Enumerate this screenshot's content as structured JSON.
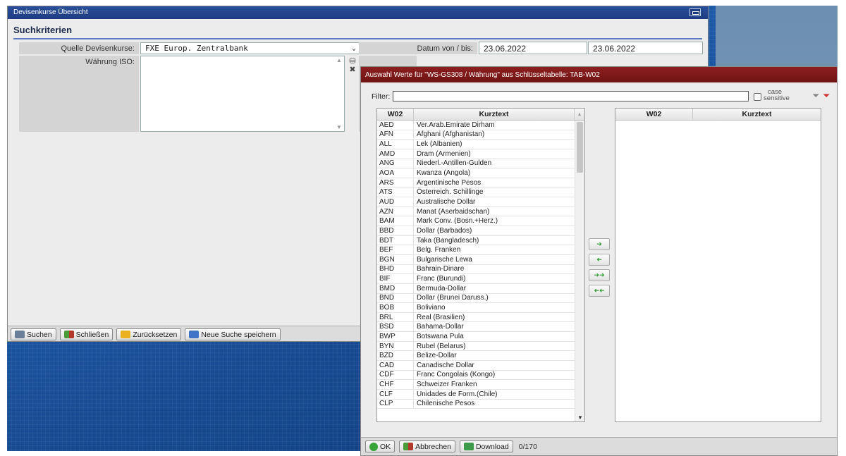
{
  "main": {
    "title": "Devisenkurse Übersicht",
    "section_title": "Suchkriterien",
    "quelle_label": "Quelle Devisenkurse:",
    "quelle_value": "FXE Europ. Zentralbank",
    "datum_label": "Datum von / bis:",
    "datum_from": "23.06.2022",
    "datum_to": "23.06.2022",
    "waehrung_label": "Währung ISO:",
    "buttons": {
      "suchen": "Suchen",
      "schliessen": "Schließen",
      "zuruecksetzen": "Zurücksetzen",
      "neue_suche": "Neue Suche speichern"
    }
  },
  "dialog": {
    "title": "Auswahl Werte für \"WS-GS308 / Währung\" aus Schlüsseltabelle: TAB-W02",
    "filter_label": "Filter:",
    "filter_value": "",
    "case_sensitive_label_1": "case",
    "case_sensitive_label_2": "sensitive",
    "left_headers": [
      "W02",
      "Kurztext"
    ],
    "right_headers": [
      "W02",
      "Kurztext"
    ],
    "rows": [
      [
        "AED",
        "Ver.Arab.Emirate Dirham"
      ],
      [
        "AFN",
        "Afghani (Afghanistan)"
      ],
      [
        "ALL",
        "Lek (Albanien)"
      ],
      [
        "AMD",
        "Dram (Armenien)"
      ],
      [
        "ANG",
        "Niederl.-Antillen-Gulden"
      ],
      [
        "AOA",
        "Kwanza (Angola)"
      ],
      [
        "ARS",
        "Argentinische Pesos"
      ],
      [
        "ATS",
        "Österreich. Schillinge"
      ],
      [
        "AUD",
        "Australische Dollar"
      ],
      [
        "AZN",
        "Manat (Aserbaidschan)"
      ],
      [
        "BAM",
        "Mark Conv. (Bosn.+Herz.)"
      ],
      [
        "BBD",
        "Dollar (Barbados)"
      ],
      [
        "BDT",
        "Taka (Bangladesch)"
      ],
      [
        "BEF",
        "Belg. Franken"
      ],
      [
        "BGN",
        "Bulgarische Lewa"
      ],
      [
        "BHD",
        "Bahrain-Dinare"
      ],
      [
        "BIF",
        "Franc (Burundi)"
      ],
      [
        "BMD",
        "Bermuda-Dollar"
      ],
      [
        "BND",
        "Dollar (Brunei Daruss.)"
      ],
      [
        "BOB",
        "Boliviano"
      ],
      [
        "BRL",
        "Real (Brasilien)"
      ],
      [
        "BSD",
        "Bahama-Dollar"
      ],
      [
        "BWP",
        "Botswana Pula"
      ],
      [
        "BYN",
        "Rubel (Belarus)"
      ],
      [
        "BZD",
        "Belize-Dollar"
      ],
      [
        "CAD",
        "Canadische Dollar"
      ],
      [
        "CDF",
        "Franc Congolais (Kongo)"
      ],
      [
        "CHF",
        "Schweizer Franken"
      ],
      [
        "CLF",
        "Unidades de Form.(Chile)"
      ],
      [
        "CLP",
        "Chilenische Pesos"
      ]
    ],
    "buttons": {
      "ok": "OK",
      "abbrechen": "Abbrechen",
      "download": "Download"
    },
    "counter": "0/170"
  },
  "colors": {
    "main_title_bar": "#1d3c84",
    "dialog_title_bar": "#7a1818",
    "accent_green": "#2e9a32"
  }
}
